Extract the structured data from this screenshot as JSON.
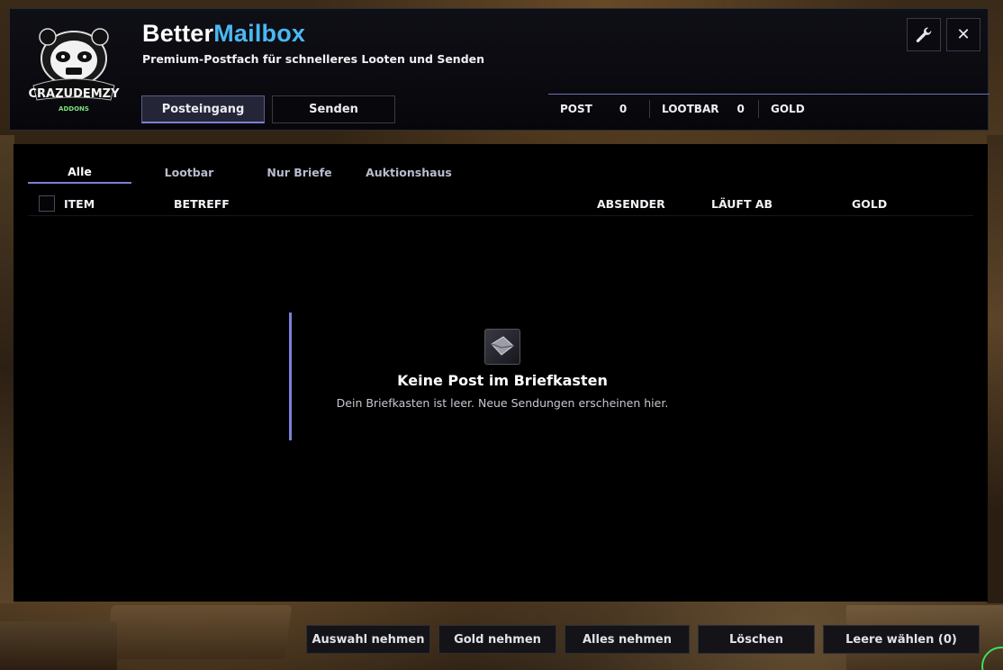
{
  "header": {
    "logo_text": "CRAZUDEMZY",
    "logo_subtext": "ADDONS",
    "title_part1": "Better",
    "title_part2": "Mailbox",
    "subtitle": "Premium-Postfach für schnelleres Looten und Senden",
    "settings_icon": "wrench-icon",
    "close_label": "✕",
    "accent_color": "#49b8f2"
  },
  "main_tabs": [
    {
      "label": "Posteingang",
      "active": true
    },
    {
      "label": "Senden",
      "active": false
    }
  ],
  "stats": {
    "post_label": "POST",
    "post_value": "0",
    "loot_label": "LOOTBAR",
    "loot_value": "0",
    "gold_label": "GOLD"
  },
  "filters": [
    {
      "label": "Alle",
      "active": true
    },
    {
      "label": "Lootbar",
      "active": false
    },
    {
      "label": "Nur Briefe",
      "active": false
    },
    {
      "label": "Auktionshaus",
      "active": false
    }
  ],
  "table": {
    "columns": [
      "ITEM",
      "BETREFF",
      "ABSENDER",
      "LÄUFT AB",
      "GOLD"
    ],
    "rows": []
  },
  "empty_state": {
    "icon": "envelope-icon",
    "title": "Keine Post im Briefkasten",
    "text": "Dein Briefkasten ist leer. Neue Sendungen erscheinen hier."
  },
  "footer": {
    "take_selection": "Auswahl nehmen",
    "take_gold": "Gold nehmen",
    "take_all": "Alles nehmen",
    "delete": "Löschen",
    "select_empty": "Leere wählen (0)"
  }
}
